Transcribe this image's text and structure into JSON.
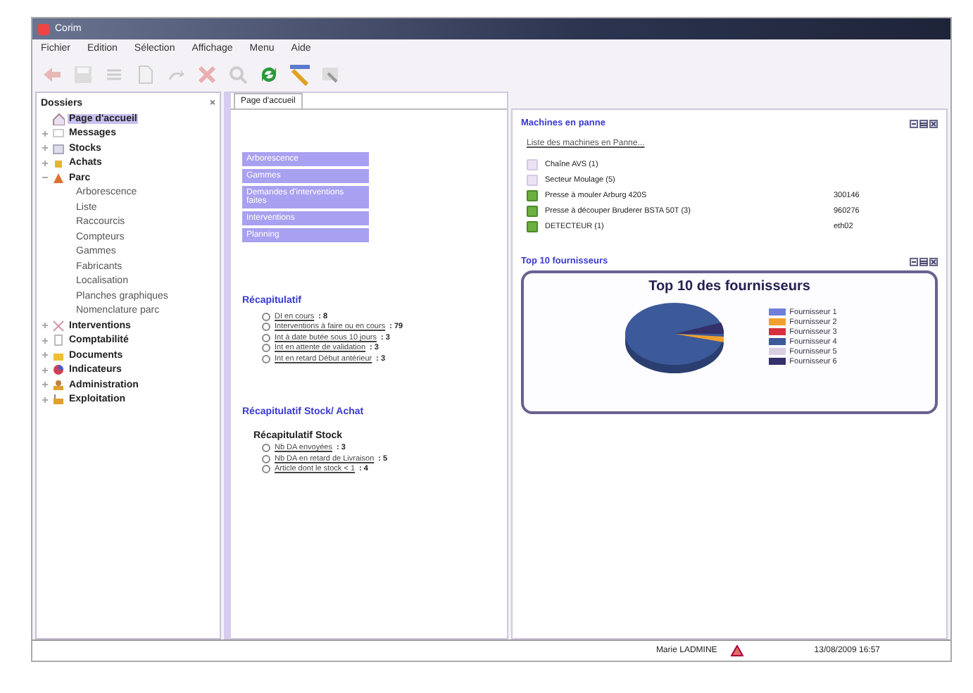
{
  "window": {
    "title": "Corim"
  },
  "menu": [
    "Fichier",
    "Edition",
    "Sélection",
    "Affichage",
    "Menu",
    "Aide"
  ],
  "sidebar": {
    "title": "Dossiers",
    "close": "×",
    "items": [
      {
        "label": "Page d'accueil",
        "selected": true
      },
      {
        "label": "Messages",
        "selected": false,
        "expanded": false
      },
      {
        "label": "Stocks",
        "selected": false,
        "expanded": false
      },
      {
        "label": "Achats",
        "selected": false,
        "expanded": false
      },
      {
        "label": "Parc",
        "selected": false,
        "expanded": true,
        "children": [
          {
            "label": "Arborescence",
            "selected": false
          },
          {
            "label": "Liste",
            "selected": false
          },
          {
            "label": "Raccourcis",
            "selected": false
          },
          {
            "label": "Compteurs",
            "selected": false
          },
          {
            "label": "Gammes",
            "selected": false
          },
          {
            "label": "Fabricants",
            "selected": false
          },
          {
            "label": "Localisation",
            "selected": false
          },
          {
            "label": "Planches graphiques",
            "selected": false
          },
          {
            "label": "Nomenclature parc",
            "selected": false
          }
        ]
      },
      {
        "label": "Interventions",
        "selected": false,
        "expanded": false
      },
      {
        "label": "Comptabilité",
        "selected": false,
        "expanded": false
      },
      {
        "label": "Documents",
        "selected": false,
        "expanded": false
      },
      {
        "label": "Indicateurs",
        "selected": false,
        "expanded": false
      },
      {
        "label": "Administration",
        "selected": false,
        "expanded": false
      },
      {
        "label": "Exploitation",
        "selected": false,
        "expanded": false
      }
    ]
  },
  "tabs": [
    {
      "label": "Page d'accueil",
      "selected": true
    }
  ],
  "shortcuts": [
    "Arborescence",
    "Gammes",
    "Demandes d'interventions faites",
    "Interventions",
    "Planning"
  ],
  "recap": {
    "title": "Récapitulatif",
    "items": [
      {
        "link": "DI en cours",
        "count": ": 8"
      },
      {
        "link": "Interventions à faire ou en cours",
        "count": ": 79"
      },
      {
        "link": "Int à date butée sous 10 jours",
        "count": ": 3"
      },
      {
        "link": "Int en attente de validation",
        "count": ": 3"
      },
      {
        "link": "Int en retard Début antérieur",
        "count": ": 3"
      }
    ]
  },
  "recap_stock": {
    "title": "Récapitulatif Stock/ Achat",
    "subtitle": "Récapitulatif Stock",
    "items": [
      {
        "link": "Nb DA envoyées",
        "count": ": 3"
      },
      {
        "link": "Nb DA en retard de Livraison",
        "count": ": 5"
      },
      {
        "link": "Article dont le stock < 1",
        "count": ": 4"
      }
    ]
  },
  "machines": {
    "title": "Machines en panne",
    "link": "Liste des machines en Panne...",
    "items": [
      {
        "kind": "group",
        "name": "Chaîne AVS (1)"
      },
      {
        "kind": "group",
        "name": "Secteur Moulage (5)"
      },
      {
        "kind": "machine",
        "name": "Presse à mouler Arburg 420S",
        "code": "300146"
      },
      {
        "kind": "machine",
        "name": "Presse à découper Bruderer BSTA 50T (3)",
        "code": "960276"
      },
      {
        "kind": "machine",
        "name": "DETECTEUR (1)",
        "code": "eth02"
      }
    ]
  },
  "suppliers": {
    "title": "Top 10 fournisseurs",
    "chart_title": "Top 10 des fournisseurs",
    "legend": [
      {
        "label": "Fournisseur 1",
        "color": "#6f7fd8"
      },
      {
        "label": "Fournisseur 2",
        "color": "#f0a030"
      },
      {
        "label": "Fournisseur 3",
        "color": "#d83040"
      },
      {
        "label": "Fournisseur 4",
        "color": "#3c5a9a"
      },
      {
        "label": "Fournisseur 5",
        "color": "#d8d0e0"
      },
      {
        "label": "Fournisseur 6",
        "color": "#34306a"
      }
    ]
  },
  "status_bar": {
    "user": "Marie LADMINE",
    "datetime": "13/08/2009 16:57"
  }
}
